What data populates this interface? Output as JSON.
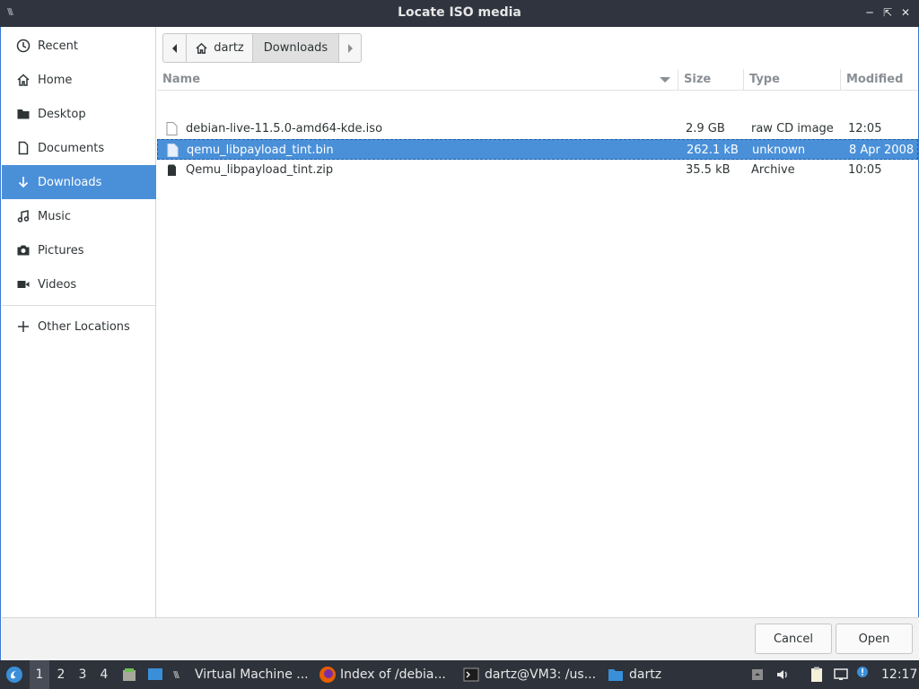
{
  "window": {
    "title": "Locate ISO media",
    "app_icon_text": "\\\\\\"
  },
  "sidebar": {
    "items": [
      {
        "label": "Recent",
        "icon": "clock-icon"
      },
      {
        "label": "Home",
        "icon": "home-icon"
      },
      {
        "label": "Desktop",
        "icon": "folder-icon"
      },
      {
        "label": "Documents",
        "icon": "document-icon"
      },
      {
        "label": "Downloads",
        "icon": "download-icon",
        "active": true
      },
      {
        "label": "Music",
        "icon": "music-icon"
      },
      {
        "label": "Pictures",
        "icon": "camera-icon"
      },
      {
        "label": "Videos",
        "icon": "video-icon"
      },
      {
        "label": "Other Locations",
        "icon": "plus-icon"
      }
    ]
  },
  "pathbar": {
    "home_label": "dartz",
    "current_label": "Downloads"
  },
  "columns": {
    "name": "Name",
    "size": "Size",
    "type": "Type",
    "modified": "Modified"
  },
  "files": [
    {
      "name": "debian-live-11.5.0-amd64-kde.iso",
      "size": "2.9 GB",
      "type": "raw CD image",
      "modified": "12:05",
      "icon": "file-icon"
    },
    {
      "name": "qemu_libpayload_tint.bin",
      "size": "262.1 kB",
      "type": "unknown",
      "modified": "8 Apr 2008",
      "icon": "file-icon",
      "selected": true
    },
    {
      "name": "Qemu_libpayload_tint.zip",
      "size": "35.5 kB",
      "type": "Archive",
      "modified": "10:05",
      "icon": "archive-icon"
    }
  ],
  "actions": {
    "cancel_label": "Cancel",
    "open_label": "Open"
  },
  "taskbar": {
    "workspaces": [
      "1",
      "2",
      "3",
      "4"
    ],
    "active_workspace": "1",
    "tasks": [
      {
        "label": "Virtual Machine ..."
      },
      {
        "label": "Index of /debia..."
      },
      {
        "label": "dartz@VM3: /us..."
      },
      {
        "label": "dartz"
      }
    ],
    "clock": "12:17"
  },
  "colors": {
    "accent": "#4a90d9",
    "titlebar": "#2f343f",
    "taskbar": "#2e323b"
  }
}
